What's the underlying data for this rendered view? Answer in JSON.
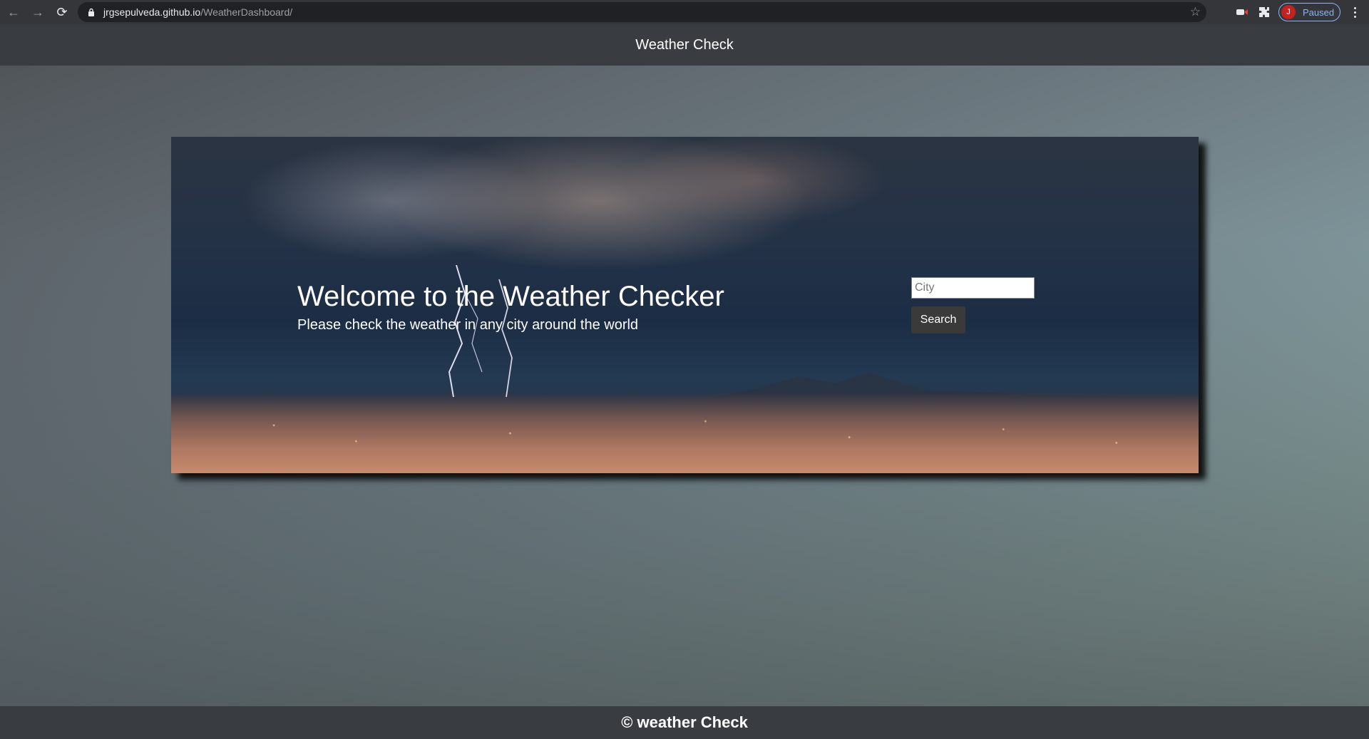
{
  "browser": {
    "url_host": "jrgsepulveda.github.io",
    "url_path": "/WeatherDashboard/",
    "profile_initial": "J",
    "profile_status": "Paused"
  },
  "header": {
    "title": "Weather Check"
  },
  "hero": {
    "title": "Welcome to the Weather Checker",
    "subtitle": "Please check the weather in any city around the world"
  },
  "search": {
    "placeholder": "City",
    "value": "",
    "button_label": "Search"
  },
  "footer": {
    "text": "© weather Check"
  }
}
